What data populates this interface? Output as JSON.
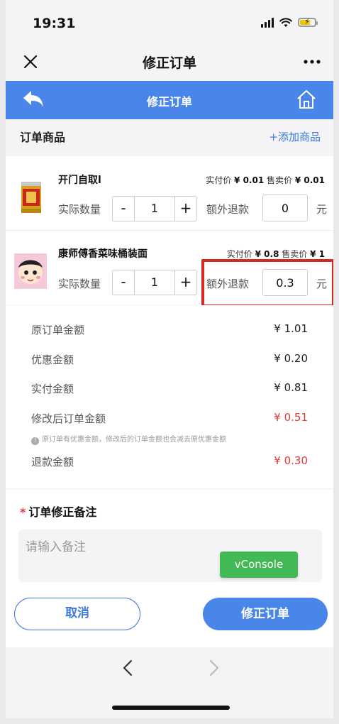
{
  "status": {
    "time": "19:31"
  },
  "wechat_nav": {
    "title": "修正订单",
    "close_icon": "close-icon",
    "more_icon": "more-icon"
  },
  "header": {
    "title": "修正订单",
    "back_icon": "back-arrow-icon",
    "home_icon": "home-icon",
    "color": "#4a86ea"
  },
  "section": {
    "title": "订单商品",
    "add_label": "+添加商品"
  },
  "goods": [
    {
      "name": "开门自取l",
      "paid_label": "实付价",
      "paid_value": "¥ 0.01",
      "sale_label": "售卖价",
      "sale_value": "¥ 0.01",
      "qty_label": "实际数量",
      "minus": "-",
      "qty": "1",
      "plus": "+",
      "refund_label": "额外退款",
      "refund_value": "0",
      "unit": "元"
    },
    {
      "name": "康师傅香菜味桶装面",
      "paid_label": "实付价",
      "paid_value": "¥ 0.8",
      "sale_label": "售卖价",
      "sale_value": "¥ 1",
      "qty_label": "实际数量",
      "minus": "-",
      "qty": "1",
      "plus": "+",
      "refund_label": "额外退款",
      "refund_value": "0.3",
      "unit": "元"
    }
  ],
  "summary": {
    "original_label": "原订单金额",
    "original_value": "¥ 1.01",
    "discount_label": "优惠金额",
    "discount_value": "¥ 0.20",
    "paid_label": "实付金额",
    "paid_value": "¥ 0.81",
    "modified_label": "修改后订单金额",
    "modified_value": "¥ 0.51",
    "note": "原订单有优惠金额，修改后的订单金额也会减去原优惠金额",
    "refund_label": "退款金额",
    "refund_value": "¥ 0.30"
  },
  "remark": {
    "required_mark": "*",
    "title": "订单修正备注",
    "placeholder": "请输入备注"
  },
  "vconsole": {
    "label": "vConsole"
  },
  "actions": {
    "cancel": "取消",
    "submit": "修正订单"
  },
  "bottom_nav": {
    "back": "‹",
    "forward": "›"
  }
}
